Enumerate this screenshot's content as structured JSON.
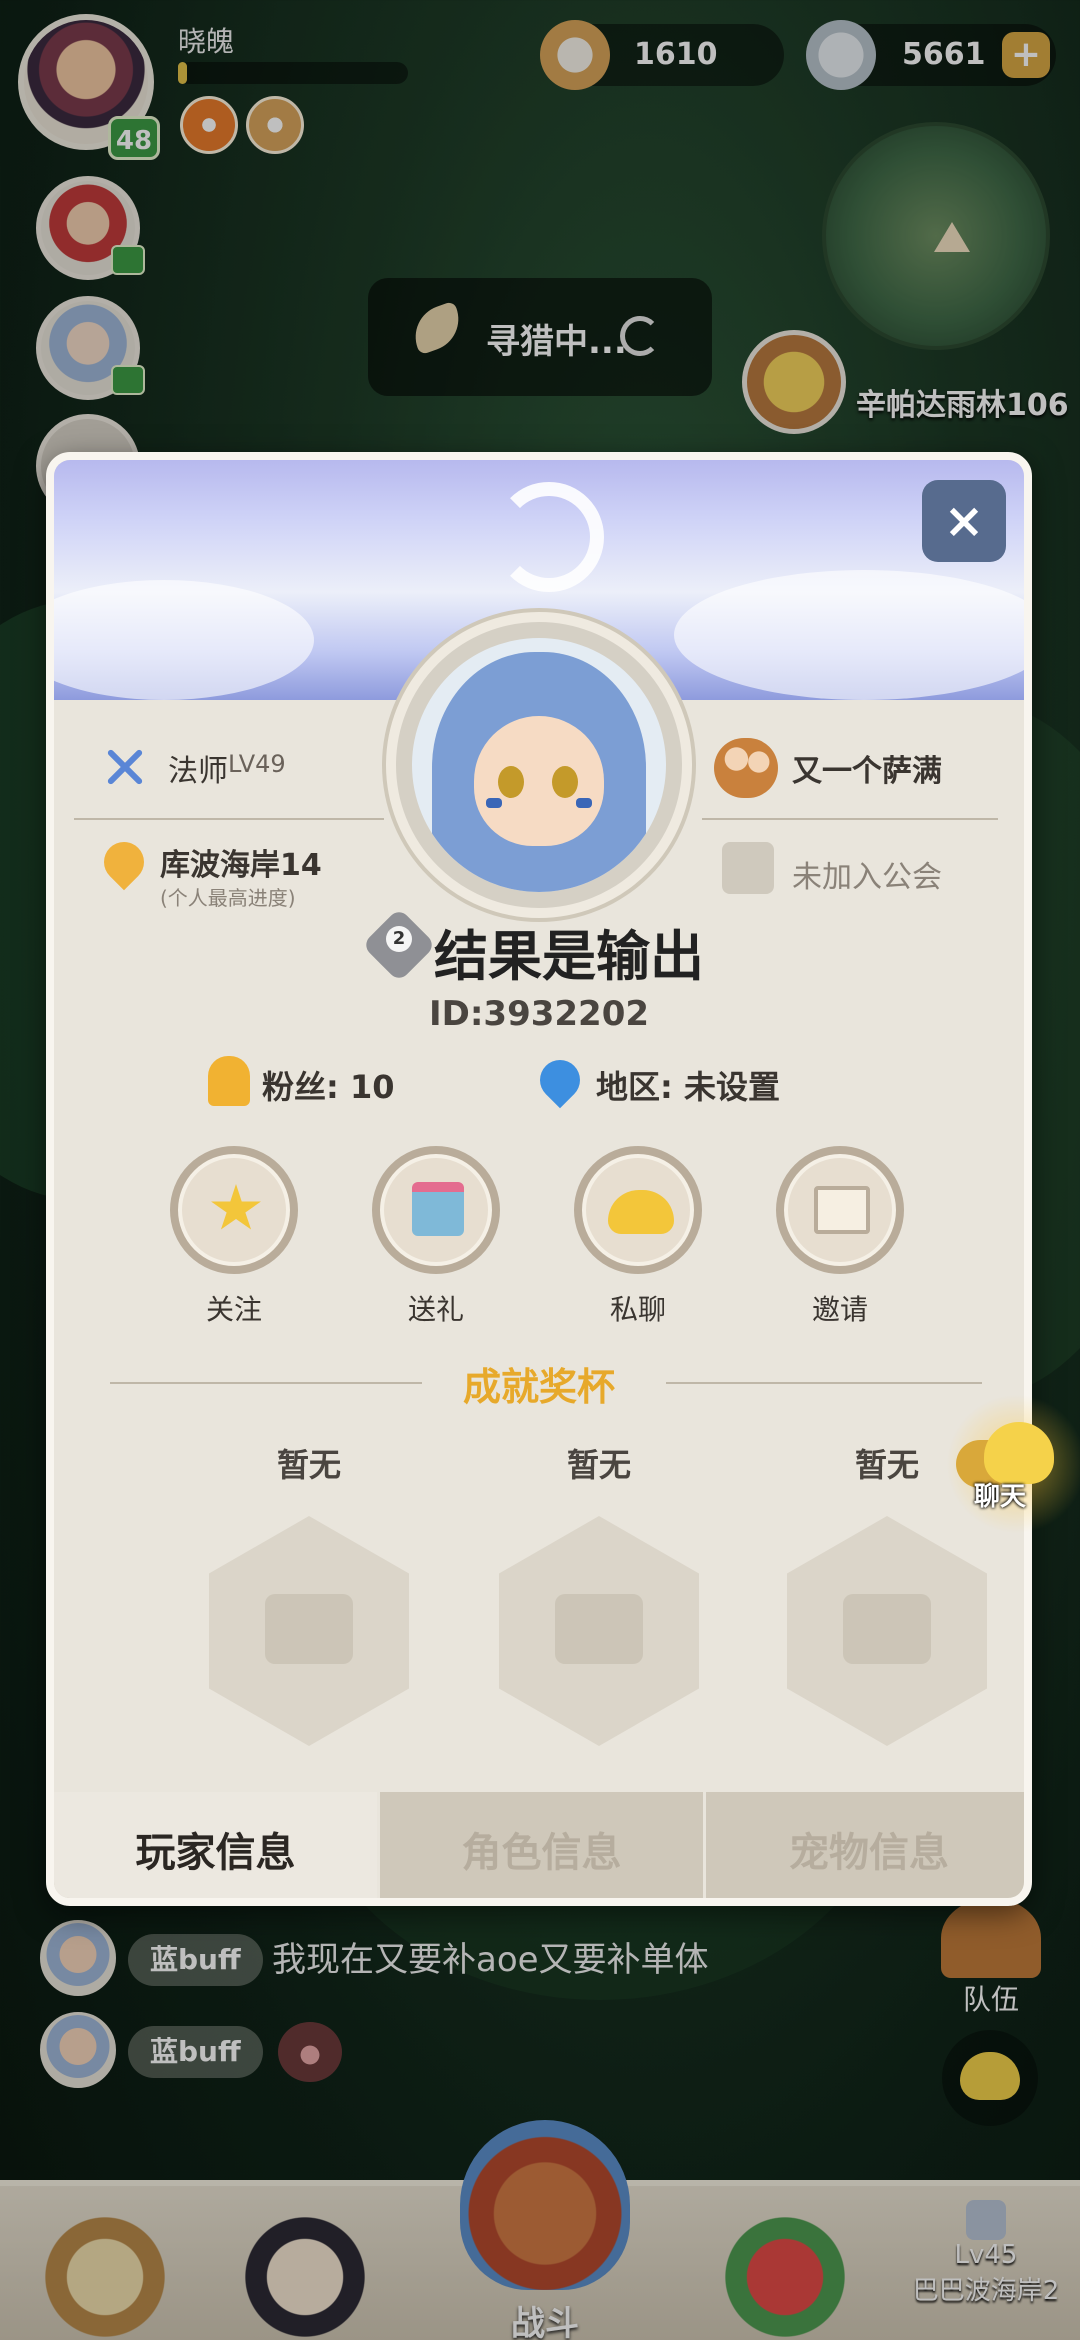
{
  "hud": {
    "player_name": "晓魄",
    "player_level": "48",
    "exp_progress": 0.04,
    "currency_shells": "1610",
    "currency_stones": "5661",
    "plus_label": "+",
    "searching_text": "寻猎中...",
    "npc_label": "辛帕达雨林106"
  },
  "chat": [
    {
      "tag": "蓝buff",
      "message": "我现在又要补aoe又要补单体"
    },
    {
      "tag": "蓝buff",
      "message": ""
    }
  ],
  "side_buttons": {
    "team_label": "队伍",
    "floating_chat_label": "聊天"
  },
  "bottom_bar": {
    "battle_label": "战斗",
    "locked_level": "Lv45",
    "locked_area": "巴巴波海岸2"
  },
  "profile": {
    "close_label": "×",
    "class_text": "法师",
    "class_level": "LV49",
    "progress_area": "库波海岸14",
    "progress_note": "(个人最高进度)",
    "partner_name": "又一个萨满",
    "guild_text": "未加入公会",
    "rank_number": "2",
    "player_name": "结果是输出",
    "player_id": "ID:3932202",
    "fans": "粉丝: 10",
    "region": "地区: 未设置",
    "actions": [
      {
        "label": "关注",
        "icon": "star-icon"
      },
      {
        "label": "送礼",
        "icon": "gift-icon"
      },
      {
        "label": "私聊",
        "icon": "chat-icon"
      },
      {
        "label": "邀请",
        "icon": "mail-icon"
      }
    ],
    "achievements_title": "成就奖杯",
    "trophies": [
      {
        "label": "暂无"
      },
      {
        "label": "暂无"
      },
      {
        "label": "暂无"
      }
    ],
    "tabs": [
      {
        "label": "玩家信息",
        "active": true
      },
      {
        "label": "角色信息",
        "active": false
      },
      {
        "label": "宠物信息",
        "active": false
      }
    ]
  },
  "colors": {
    "accent_gold": "#e7a92b",
    "card_bg": "#e9e5dc",
    "close_btn": "#576b8e",
    "level_badge": "#3d9b45"
  }
}
